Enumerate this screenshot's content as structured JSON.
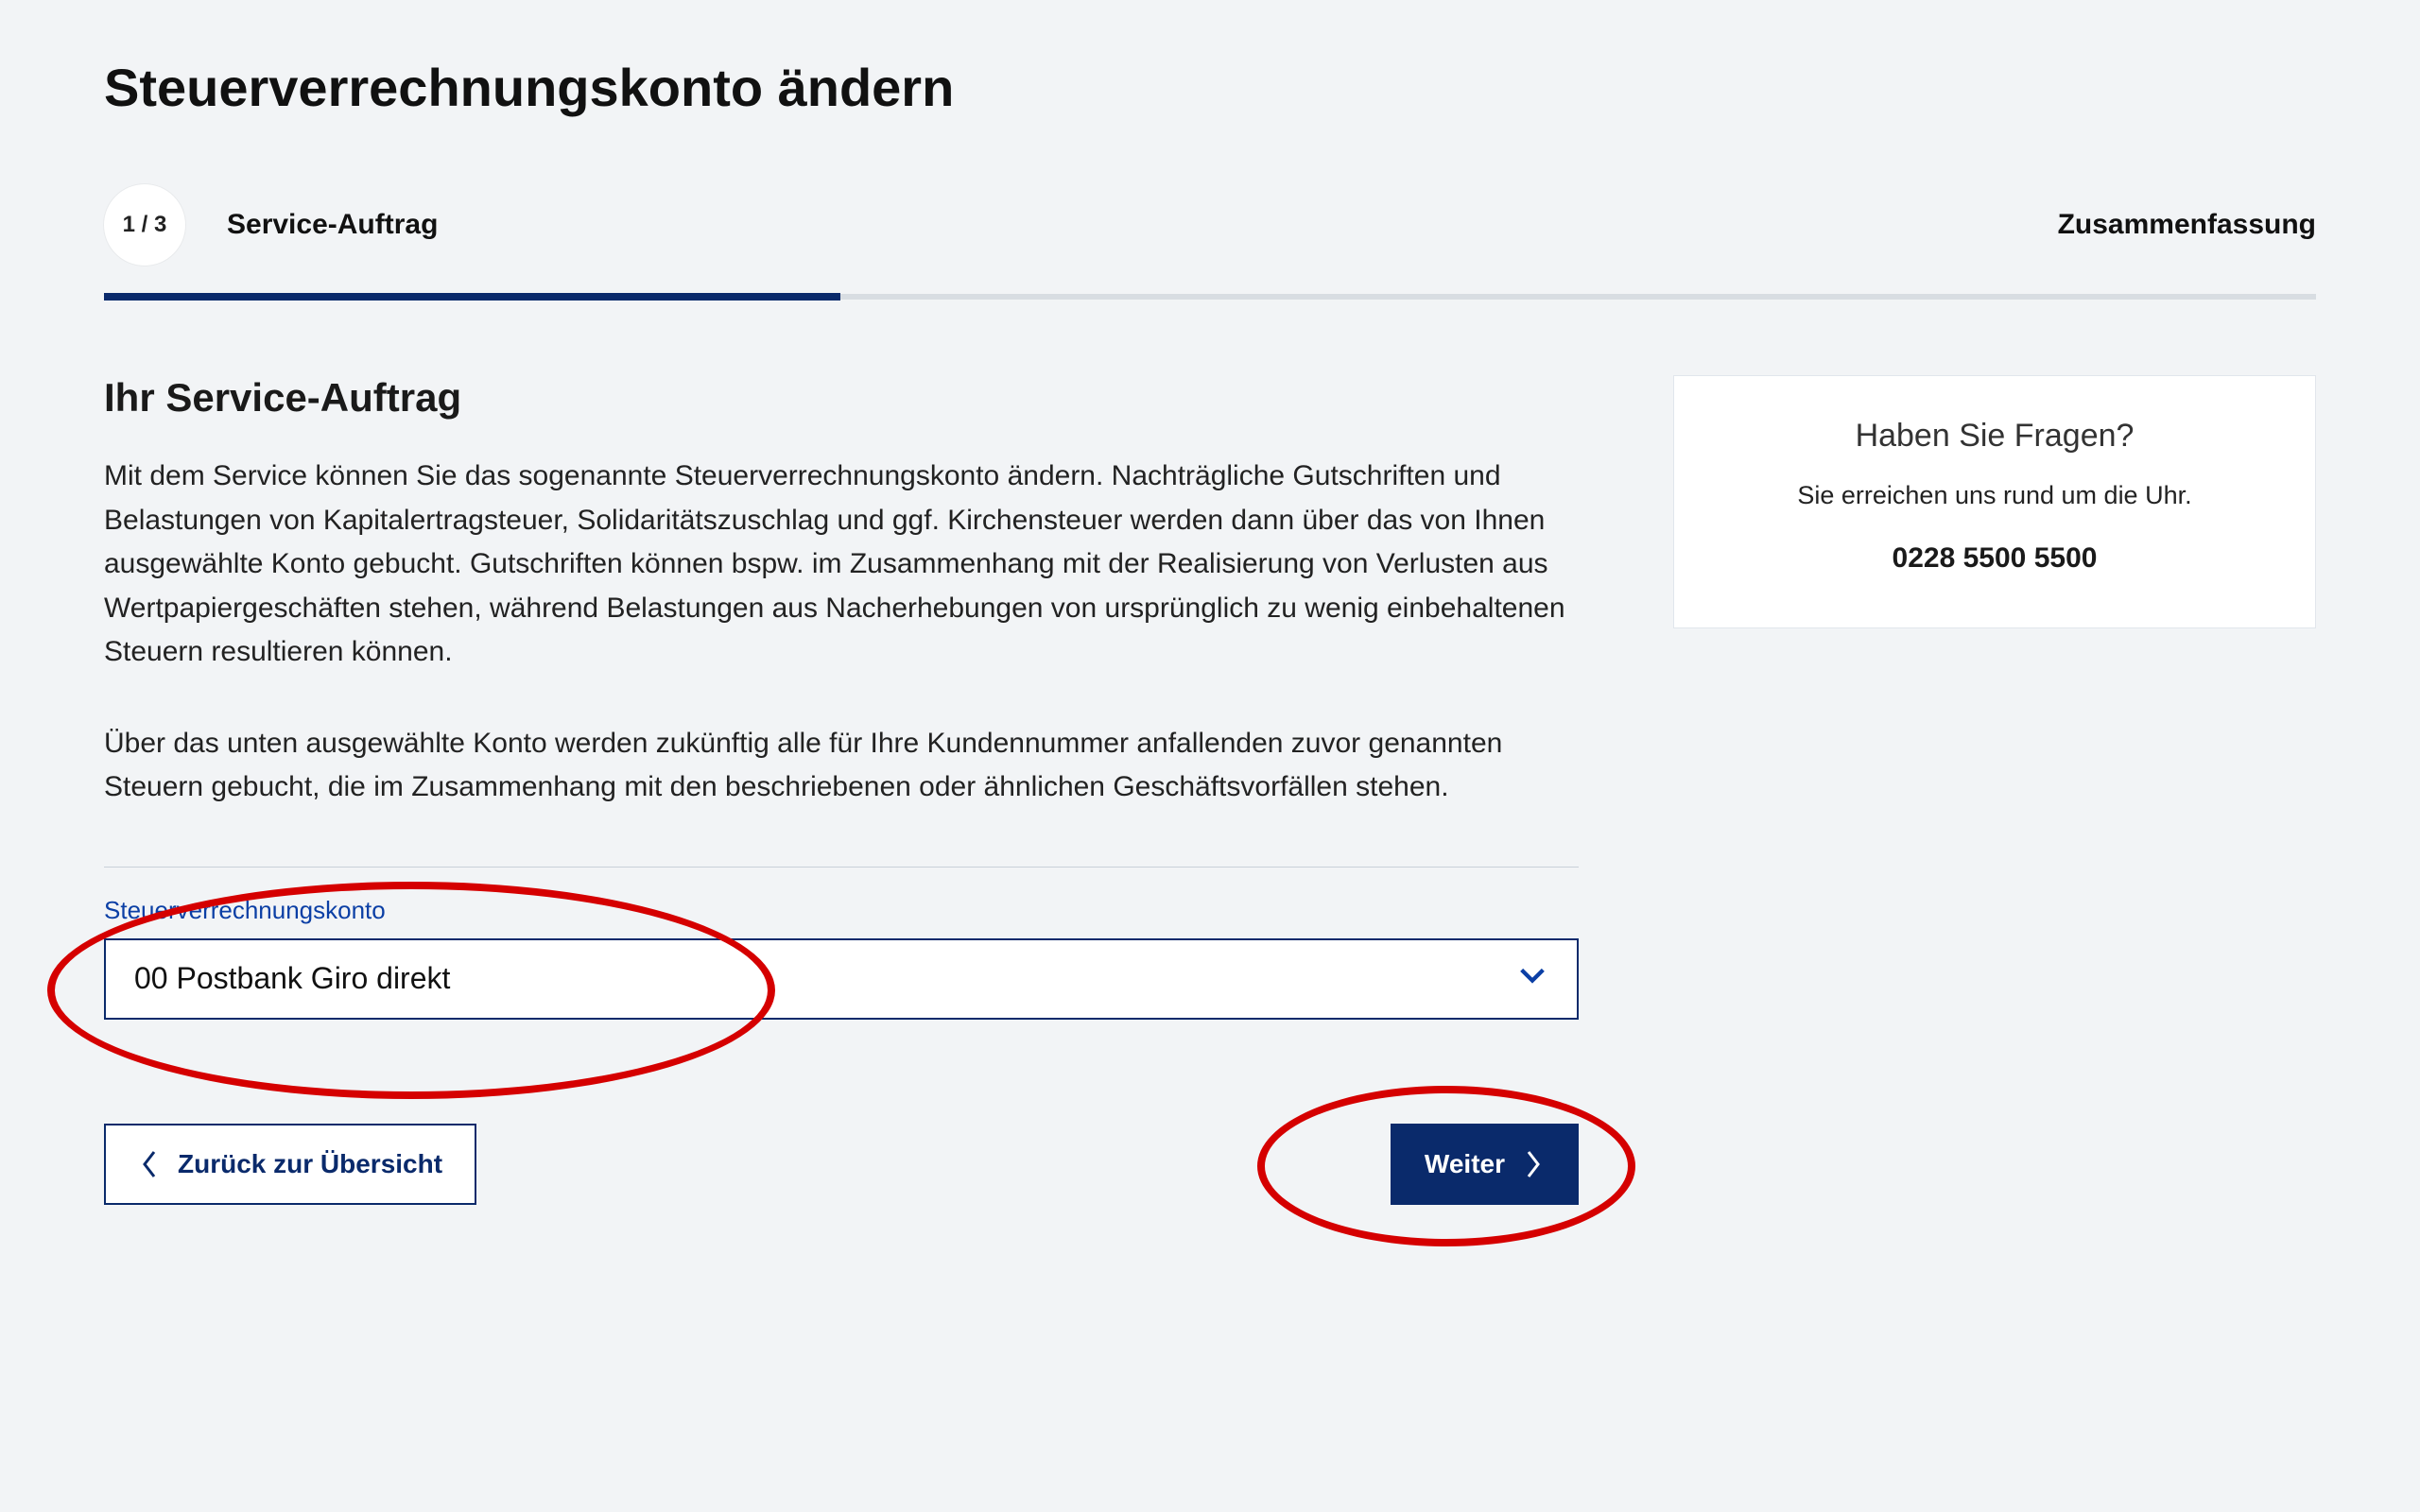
{
  "page": {
    "title": "Steuerverrechnungskonto ändern"
  },
  "wizard": {
    "step_indicator": "1 / 3",
    "current_step_label": "Service-Auftrag",
    "final_step_label": "Zusammenfassung"
  },
  "main": {
    "section_title": "Ihr Service-Auftrag",
    "paragraph_1": "Mit dem Service können Sie das sogenannte Steuerverrechnungskonto ändern. Nachträgliche Gutschriften und Belastungen von Kapitalertragsteuer, Solidaritätszuschlag und ggf. Kirchensteuer werden dann über das von Ihnen ausgewählte Konto gebucht. Gutschriften können bspw. im Zusammenhang mit der Realisierung von Verlusten aus Wertpapiergeschäften stehen, während Belastungen aus Nacherhebungen von ursprünglich zu wenig einbehaltenen Steuern resultieren können.",
    "paragraph_2": "Über das unten ausgewählte Konto werden zukünftig alle für Ihre Kundennummer anfallenden zuvor genannten Steuern gebucht, die im Zusammenhang mit den beschriebenen oder ähnlichen Geschäftsvorfällen stehen."
  },
  "form": {
    "field_label": "Steuerverrechnungskonto",
    "selected_value": "00 Postbank Giro direkt"
  },
  "actions": {
    "back_label": "Zurück zur Übersicht",
    "next_label": "Weiter"
  },
  "help": {
    "title": "Haben Sie Fragen?",
    "text": "Sie erreichen uns rund um die Uhr.",
    "phone": "0228 5500 5500"
  }
}
